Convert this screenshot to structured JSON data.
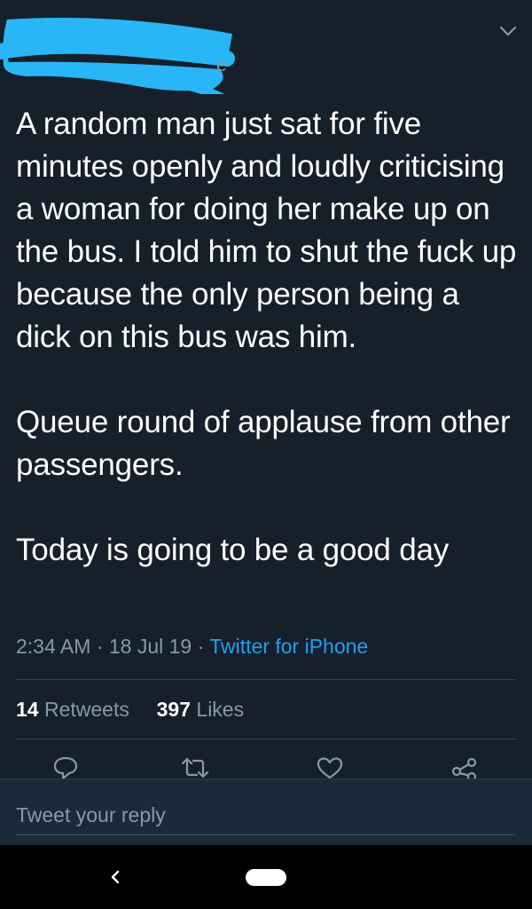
{
  "header": {
    "name_fragment": "e",
    "redaction_color": "#29b6f6",
    "menu_icon": "chevron-down-icon"
  },
  "tweet": {
    "paragraphs": [
      "A random man just sat for five minutes openly and loudly criticising a woman for doing her make up on the bus. I told him to shut the fuck up because the only person being a dick on this bus was him.",
      "Queue round of applause from other passengers.",
      "Today is going to be a good day"
    ],
    "time": "2:34 AM",
    "separator": "·",
    "date": "18 Jul 19",
    "source": "Twitter for iPhone"
  },
  "stats": {
    "retweets_count": "14",
    "retweets_label": "Retweets",
    "likes_count": "397",
    "likes_label": "Likes"
  },
  "actions": [
    {
      "icon": "reply-icon"
    },
    {
      "icon": "retweet-icon"
    },
    {
      "icon": "heart-icon"
    },
    {
      "icon": "share-icon"
    }
  ],
  "reply": {
    "placeholder": "Tweet your reply"
  },
  "colors": {
    "background": "#15202b",
    "text": "#ffffff",
    "secondary_text": "#8899a6",
    "link": "#1da1f2",
    "reply_bar": "#1c2938"
  },
  "nav": {
    "back_icon": "back-arrow-icon",
    "home_icon": "home-pill-icon"
  }
}
